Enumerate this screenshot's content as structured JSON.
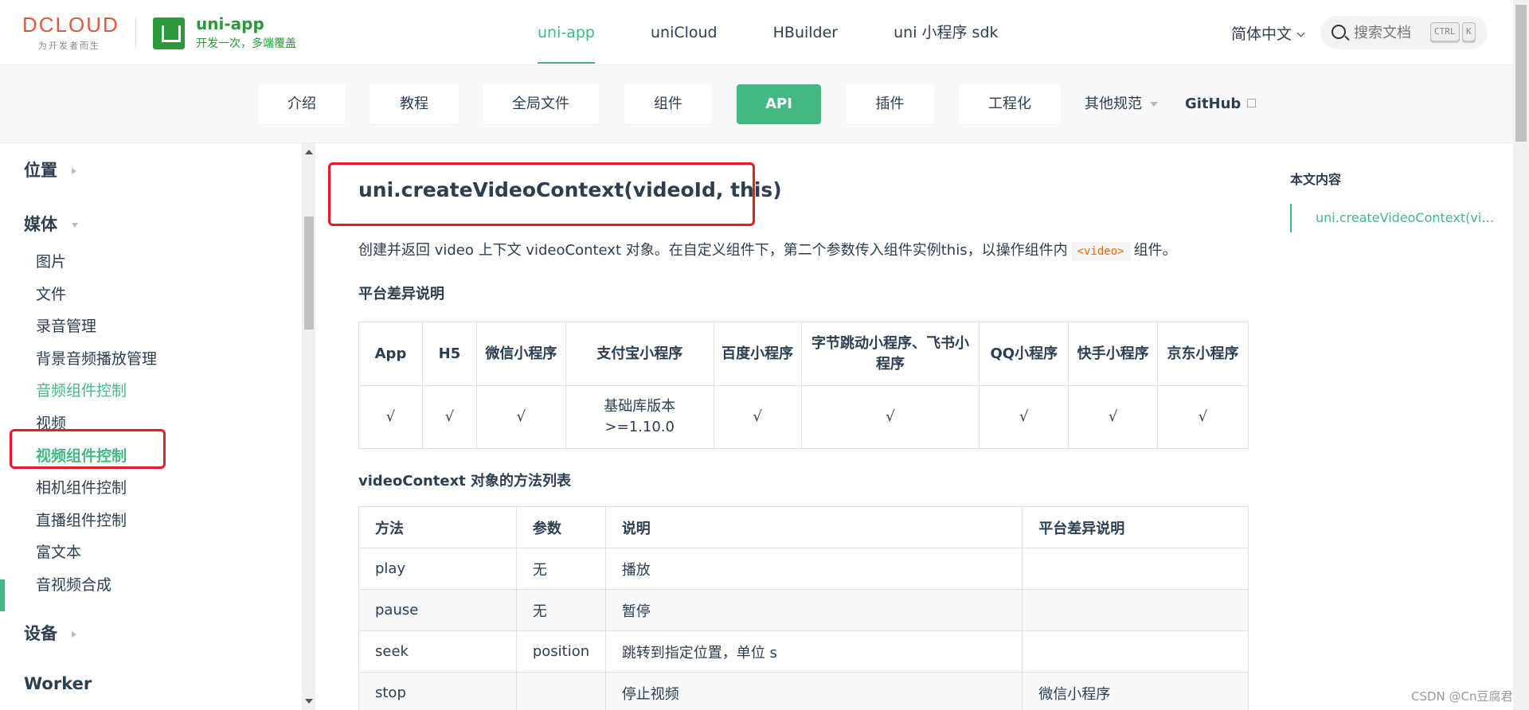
{
  "brand": {
    "logo_text": "DCLOUD",
    "logo_sub": "为开发者而生",
    "product_title": "uni-app",
    "product_sub": "开发一次，多端覆盖"
  },
  "topnav": [
    "uni-app",
    "uniCloud",
    "HBuilder",
    "uni 小程序 sdk"
  ],
  "topnav_active": "uni-app",
  "lang": "简体中文",
  "search": {
    "placeholder": "搜索文档",
    "kbd1": "CTRL",
    "kbd2": "K"
  },
  "subnav": {
    "buttons": [
      "介绍",
      "教程",
      "全局文件",
      "组件",
      "API",
      "插件",
      "工程化"
    ],
    "more": "其他规范",
    "github": "GitHub"
  },
  "sidebar": {
    "group_location": "位置",
    "group_media": "媒体",
    "items": [
      "图片",
      "文件",
      "录音管理",
      "背景音频播放管理",
      "音频组件控制",
      "视频",
      "视频组件控制",
      "相机组件控制",
      "直播组件控制",
      "富文本",
      "音视频合成"
    ],
    "group_device": "设备",
    "group_worker": "Worker"
  },
  "main": {
    "title": "uni.createVideoContext(videoId, this)",
    "desc_before": "创建并返回 video 上下文 videoContext 对象。在自定义组件下，第二个参数传入组件实例this，以操作组件内",
    "desc_code": "<video>",
    "desc_after": "组件。",
    "platform_title": "平台差异说明",
    "platform_headers": [
      "App",
      "H5",
      "微信小程序",
      "支付宝小程序",
      "百度小程序",
      "字节跳动小程序、飞书小程序",
      "QQ小程序",
      "快手小程序",
      "京东小程序"
    ],
    "platform_values": [
      "√",
      "√",
      "√",
      "基础库版本>=1.10.0",
      "√",
      "√",
      "√",
      "√",
      "√"
    ],
    "methods_title": "videoContext 对象的方法列表",
    "methods_headers": [
      "方法",
      "参数",
      "说明",
      "平台差异说明"
    ],
    "methods_rows": [
      [
        "play",
        "无",
        "播放",
        ""
      ],
      [
        "pause",
        "无",
        "暂停",
        ""
      ],
      [
        "seek",
        "position",
        "跳转到指定位置，单位 s",
        ""
      ],
      [
        "stop",
        "",
        "停止视频",
        "微信小程序"
      ]
    ]
  },
  "toc": {
    "title": "本文内容",
    "item": "uni.createVideoContext(videoId, this)"
  },
  "watermark": "CSDN @Cn豆腐君",
  "colors": {
    "accent": "#42b983",
    "brand_green": "#2b9939",
    "highlight_red": "#e51e25"
  }
}
